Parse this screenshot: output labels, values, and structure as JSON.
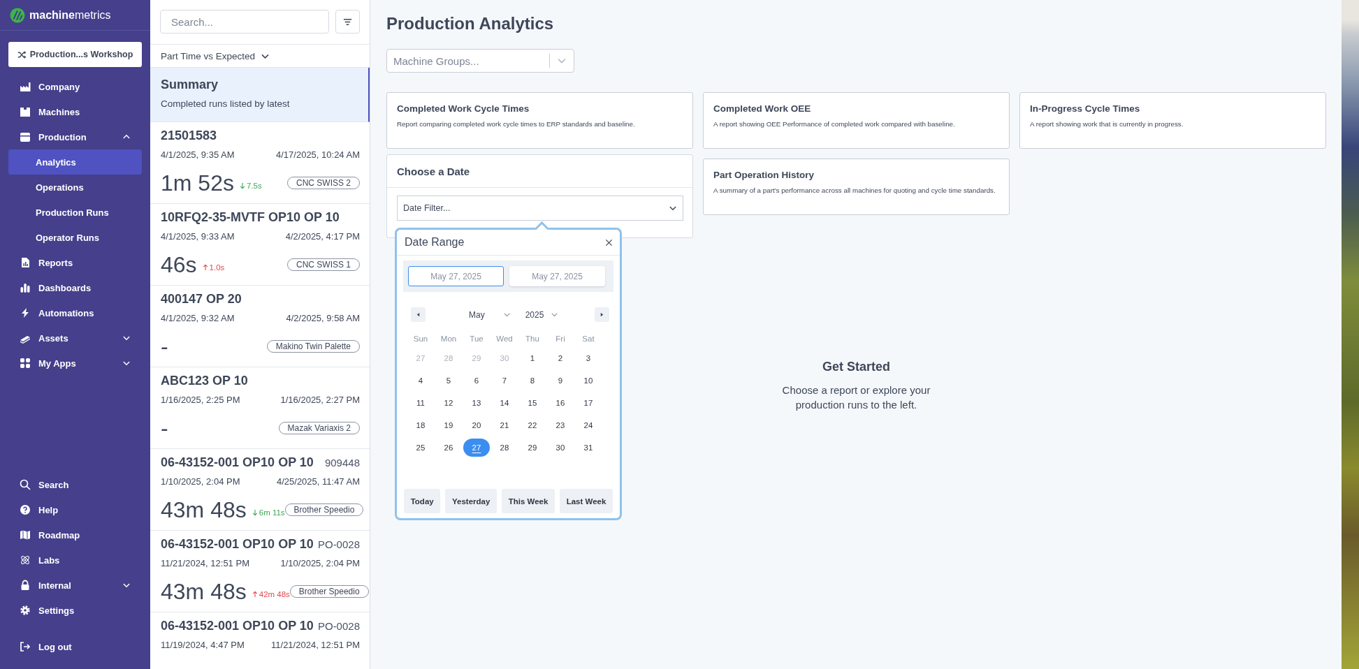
{
  "sidebar": {
    "logo": "**machine**metrics",
    "workspace_button": "Production...s Workshop",
    "main_nav": [
      {
        "label": "Company",
        "kind": "link",
        "selected": false
      },
      {
        "label": "Machines",
        "kind": "link",
        "selected": false
      },
      {
        "label": "Production",
        "kind": "group",
        "selected": false,
        "expanded": true,
        "children": [
          {
            "label": "Analytics",
            "selected": true
          },
          {
            "label": "Operations",
            "selected": false
          },
          {
            "label": "Production Runs",
            "selected": false
          },
          {
            "label": "Operator Runs",
            "selected": false
          }
        ]
      },
      {
        "label": "Reports",
        "kind": "link",
        "selected": false
      },
      {
        "label": "Dashboards",
        "kind": "link",
        "selected": false
      },
      {
        "label": "Automations",
        "kind": "link",
        "selected": false
      },
      {
        "label": "Assets",
        "kind": "group",
        "selected": false,
        "expanded": false
      },
      {
        "label": "My Apps",
        "kind": "group",
        "selected": false,
        "expanded": false
      }
    ],
    "bottom_nav": [
      {
        "label": "Search",
        "kind": "link",
        "selected": false
      },
      {
        "label": "Help",
        "kind": "link",
        "selected": false
      },
      {
        "label": "Roadmap",
        "kind": "link",
        "selected": false
      },
      {
        "label": "Labs",
        "kind": "link",
        "selected": false
      },
      {
        "label": "Internal",
        "kind": "group",
        "selected": false,
        "expanded": false
      },
      {
        "label": "Settings",
        "kind": "link",
        "selected": false
      }
    ],
    "logout": "Log out"
  },
  "runs_panel": {
    "search": {
      "placeholder": "Search..."
    },
    "sort": "Part Time vs Expected",
    "summary": {
      "title": "Summary",
      "subtitle": "Completed runs listed by latest",
      "selected": true
    },
    "runs": [
      {
        "name": "21501583",
        "start": "4/1/2025, 9:35 AM",
        "end": "4/17/2025, 10:24 AM",
        "duration": "1m 52s",
        "delta": "7.5s",
        "kind": "down",
        "machine": "CNC SWISS 2"
      },
      {
        "name": "10RFQ2-35-MVTF OP10 OP 10",
        "start": "4/1/2025, 9:33 AM",
        "end": "4/2/2025, 4:17 PM",
        "duration": "46s",
        "delta": "1.0s",
        "kind": "up",
        "machine": "CNC SWISS 1"
      },
      {
        "name": "400147 OP 20",
        "start": "4/1/2025, 9:32 AM",
        "end": "4/2/2025, 9:58 AM",
        "duration": "-",
        "machine": "Makino Twin Palette"
      },
      {
        "name": "ABC123 OP 10",
        "start": "1/16/2025, 2:25 PM",
        "end": "1/16/2025, 2:27 PM",
        "duration": "-",
        "machine": "Mazak Variaxis 2"
      },
      {
        "name": "06-43152-001 OP10 OP 10",
        "ref": "909448",
        "start": "1/10/2025, 2:04 PM",
        "end": "4/25/2025, 11:47 AM",
        "duration": "43m 48s",
        "delta": "6m 11s",
        "kind": "down",
        "machine": "Brother Speedio"
      },
      {
        "name": "06-43152-001 OP10 OP 10",
        "ref": "PO-0028",
        "start": "11/21/2024, 12:51 PM",
        "end": "1/10/2025, 2:04 PM",
        "duration": "43m 48s",
        "delta": "42m 48s",
        "kind": "up",
        "machine": "Brother Speedio"
      },
      {
        "name": "06-43152-001 OP10 OP 10",
        "ref": "PO-0028",
        "start": "11/19/2024, 4:47 PM",
        "end": "11/21/2024, 12:51 PM"
      }
    ]
  },
  "main": {
    "title": "Production Analytics",
    "machine_groups": {
      "placeholder": "Machine Groups..."
    },
    "reports": [
      {
        "title": "Completed Work Cycle Times",
        "description": "Report comparing completed work cycle times to ERP standards and baseline."
      },
      {
        "title": "Completed Work OEE",
        "description": "A report showing OEE Performance of completed work compared with baseline."
      },
      {
        "title": "In-Progress Cycle Times",
        "description": "A report showing work that is currently in progress."
      },
      {
        "title": "Part Operation History",
        "description": "A summary of a part's performance across all machines for quoting and cycle time standards."
      }
    ],
    "date_card": {
      "title": "Choose a Date",
      "filter": {
        "placeholder": "Date Filter..."
      }
    },
    "date_popover": {
      "title": "Date Range",
      "start": {
        "value": "May 27, 2025",
        "selected": true
      },
      "end": {
        "value": "May 27, 2025",
        "selected": false
      },
      "month": "May",
      "year": "2025",
      "weekdays": [
        "Sun",
        "Mon",
        "Tue",
        "Wed",
        "Thu",
        "Fri",
        "Sat"
      ],
      "days": [
        {
          "label": "27",
          "outside_month": true,
          "selected": false
        },
        {
          "label": "28",
          "outside_month": true,
          "selected": false
        },
        {
          "label": "29",
          "outside_month": true,
          "selected": false
        },
        {
          "label": "30",
          "outside_month": true,
          "selected": false
        },
        {
          "label": "1",
          "outside_month": false,
          "selected": false
        },
        {
          "label": "2",
          "outside_month": false,
          "selected": false
        },
        {
          "label": "3",
          "outside_month": false,
          "selected": false
        },
        {
          "label": "4",
          "outside_month": false,
          "selected": false
        },
        {
          "label": "5",
          "outside_month": false,
          "selected": false
        },
        {
          "label": "6",
          "outside_month": false,
          "selected": false
        },
        {
          "label": "7",
          "outside_month": false,
          "selected": false
        },
        {
          "label": "8",
          "outside_month": false,
          "selected": false
        },
        {
          "label": "9",
          "outside_month": false,
          "selected": false
        },
        {
          "label": "10",
          "outside_month": false,
          "selected": false
        },
        {
          "label": "11",
          "outside_month": false,
          "selected": false
        },
        {
          "label": "12",
          "outside_month": false,
          "selected": false
        },
        {
          "label": "13",
          "outside_month": false,
          "selected": false
        },
        {
          "label": "14",
          "outside_month": false,
          "selected": false
        },
        {
          "label": "15",
          "outside_month": false,
          "selected": false
        },
        {
          "label": "16",
          "outside_month": false,
          "selected": false
        },
        {
          "label": "17",
          "outside_month": false,
          "selected": false
        },
        {
          "label": "18",
          "outside_month": false,
          "selected": false
        },
        {
          "label": "19",
          "outside_month": false,
          "selected": false
        },
        {
          "label": "20",
          "outside_month": false,
          "selected": false
        },
        {
          "label": "21",
          "outside_month": false,
          "selected": false
        },
        {
          "label": "22",
          "outside_month": false,
          "selected": false
        },
        {
          "label": "23",
          "outside_month": false,
          "selected": false
        },
        {
          "label": "24",
          "outside_month": false,
          "selected": false
        },
        {
          "label": "25",
          "outside_month": false,
          "selected": false
        },
        {
          "label": "26",
          "outside_month": false,
          "selected": false
        },
        {
          "label": "27",
          "outside_month": false,
          "selected": true
        },
        {
          "label": "28",
          "outside_month": false,
          "selected": false
        },
        {
          "label": "29",
          "outside_month": false,
          "selected": false
        },
        {
          "label": "30",
          "outside_month": false,
          "selected": false
        },
        {
          "label": "31",
          "outside_month": false,
          "selected": false
        }
      ],
      "quick_ranges": [
        "Today",
        "Yesterday",
        "This Week",
        "Last Week"
      ]
    },
    "get_started": {
      "title": "Get Started",
      "text": "Choose a report or explore your production runs to the left."
    }
  }
}
